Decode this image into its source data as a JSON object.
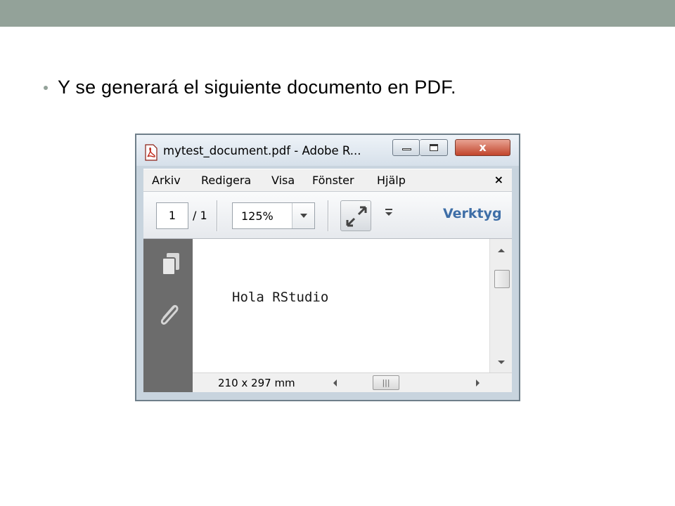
{
  "slide": {
    "bullet_text": "Y se generará el siguiente documento en PDF."
  },
  "window": {
    "title": "mytest_document.pdf - Adobe R...",
    "controls": {
      "close_glyph": "x"
    },
    "menu": [
      "Arkiv",
      "Redigera",
      "Visa",
      "Fönster",
      "Hjälp"
    ],
    "menu_close_glyph": "×",
    "toolbar": {
      "page_current": "1",
      "page_total": "/ 1",
      "zoom": "125%",
      "tools_label": "Verktyg"
    },
    "document": {
      "text": "Hola RStudio"
    },
    "status": {
      "dimensions": "210 x 297 mm"
    }
  },
  "colors": {
    "slide_accent": "#93a299",
    "tools_link": "#3e6ea7",
    "side_panel": "#6c6c6c",
    "close_button": "#c1452c"
  },
  "icons": [
    "pdf-file-icon",
    "minimize-icon",
    "maximize-icon",
    "close-icon",
    "fit-page-icon",
    "more-tools-icon",
    "pages-icon",
    "attachment-icon"
  ]
}
